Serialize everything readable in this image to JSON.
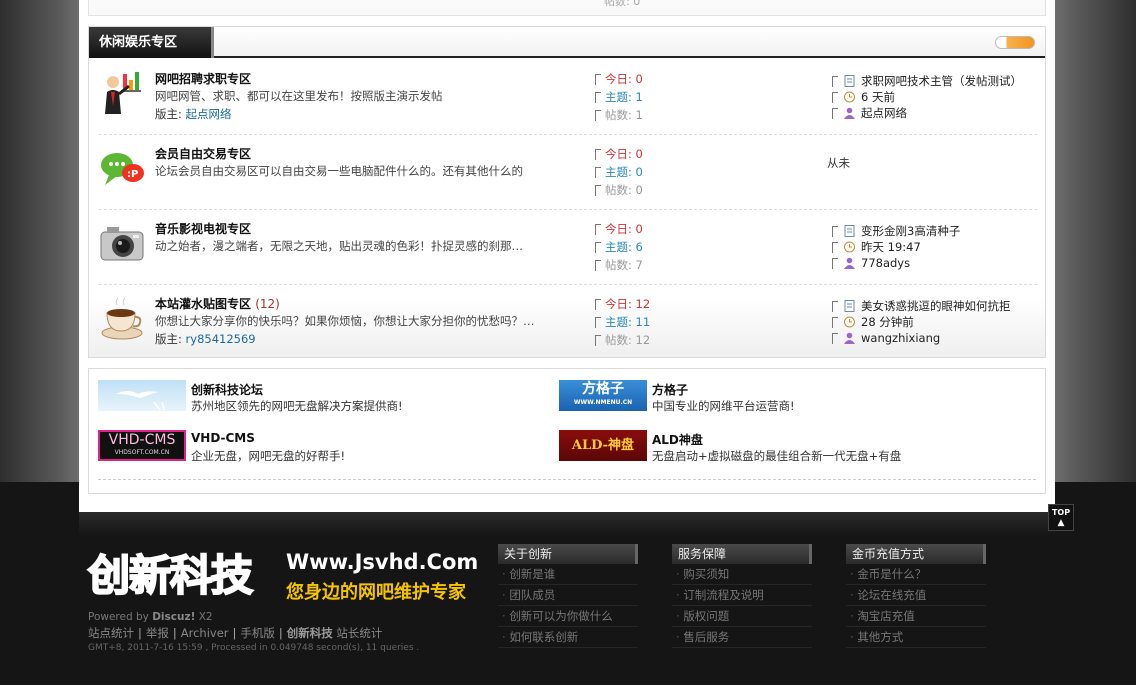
{
  "category": {
    "title": "休闲娱乐专区"
  },
  "forums": [
    {
      "title": "网吧招聘求职专区",
      "count": "",
      "desc": "网吧网管、求职、都可以在这里发布！按照版主演示发帖",
      "mod_label": "版主: ",
      "mod_name": "起点网络",
      "today": "今日: 0",
      "topics": "主题: 1",
      "posts": "帖数: 1",
      "last_title": "求职网吧技术主管（发帖测试）",
      "last_time": "6 天前",
      "last_user": "起点网络",
      "icon": "chart-presenter-icon"
    },
    {
      "title": "会员自由交易专区",
      "count": "",
      "desc": "论坛会员自由交易区可以自由交易一些电脑配件什么的。还有其他什么的",
      "mod_label": "",
      "mod_name": "",
      "today": "今日: 0",
      "topics": "主题: 0",
      "posts": "帖数: 0",
      "never": "从未",
      "icon": "chat-bubble-icon"
    },
    {
      "title": "音乐影视电视专区",
      "count": "",
      "desc": "动之始者，漫之端者，无限之天地，贴出灵魂的色彩！扑捉灵感的刹那…",
      "mod_label": "",
      "mod_name": "",
      "today": "今日: 0",
      "topics": "主题: 6",
      "posts": "帖数: 7",
      "last_title": "变形金刚3高清种子",
      "last_time": "昨天 19:47",
      "last_user": "778adys",
      "icon": "camera-icon"
    },
    {
      "title": "本站灌水贴图专区",
      "count": "(12)",
      "desc": "你想让大家分享你的快乐吗？如果你烦恼，你想让大家分担你的忧愁吗？…",
      "mod_label": "版主: ",
      "mod_name": "ry85412569",
      "today": "今日: 12",
      "topics": "主题: 11",
      "posts": "帖数: 12",
      "last_title": "美女诱惑挑逗的眼神如何抗拒",
      "last_time": "28 分钟前",
      "last_user": "wangzhixiang",
      "icon": "coffee-cup-icon"
    }
  ],
  "links": [
    {
      "name": "创新科技论坛",
      "desc": "苏州地区领先的网吧无盘解决方案提供商!",
      "banner_icon": "bird-banner-icon"
    },
    {
      "name": "方格子",
      "desc": "中国专业的网维平台运营商!",
      "banner_text": "方格子",
      "banner_sub": "WWW.NMENU.CN"
    },
    {
      "name": "VHD-CMS",
      "desc": "企业无盘，网吧无盘的好帮手!",
      "banner_text": "VHD-CMS",
      "banner_sub": "VHDSOFT.COM.CN"
    },
    {
      "name": "ALD神盘",
      "desc": "无盘启动+虚拟磁盘的最佳组合新一代无盘+有盘",
      "banner_text": "ALD-神盘"
    }
  ],
  "top_button": "TOP",
  "footer": {
    "logo_cn": "创新科技",
    "logo_url": "Www.Jsvhd.Com",
    "logo_slogan": "您身边的网吧维护专家",
    "powered_prefix": "Powered by ",
    "powered_name": "Discuz!",
    "powered_ver": " X2",
    "links": [
      "站点统计",
      "举报",
      "Archiver",
      "手机版"
    ],
    "site_name": "创新科技",
    "site_stats": "站长统计",
    "gmt": "GMT+8, 2011-7-16 15:59 , Processed in 0.049748 second(s), 11 queries .",
    "columns": [
      {
        "title": "关于创新",
        "items": [
          "创新是谁",
          "团队成员",
          "创新可以为你做什么",
          "如何联系创新"
        ]
      },
      {
        "title": "服务保障",
        "items": [
          "购买须知",
          "订制流程及说明",
          "版权问题",
          "售后服务"
        ]
      },
      {
        "title": "金币充值方式",
        "items": [
          "金币是什么？",
          "论坛在线充值",
          "淘宝店充值",
          "其他方式"
        ]
      }
    ]
  },
  "top_remnant": "帖数: 0"
}
